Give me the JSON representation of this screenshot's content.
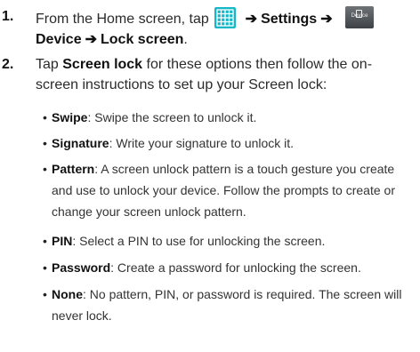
{
  "steps": [
    {
      "number": "1.",
      "prefix": "From the Home screen, tap",
      "arrow": "➔",
      "settings": "Settings",
      "device_icon_caption": "Device",
      "device": "Device",
      "lock_screen": "Lock screen",
      "period": "."
    },
    {
      "number": "2.",
      "tap": "Tap",
      "screen_lock": "Screen lock",
      "rest": "for these options then follow the on-screen instructions to set up your Screen lock:"
    }
  ],
  "options": [
    {
      "term": "Swipe",
      "desc": ": Swipe the screen to unlock it."
    },
    {
      "term": "Signature",
      "desc": ": Write your signature to unlock it."
    },
    {
      "term": "Pattern",
      "desc": ": A screen unlock pattern is a touch gesture you create and use to unlock your device. Follow the prompts to create or change your screen unlock pattern."
    },
    {
      "term": "PIN",
      "desc": ": Select a PIN to use for unlocking the screen."
    },
    {
      "term": "Password",
      "desc": ": Create a password for unlocking the screen."
    },
    {
      "term": "None",
      "desc": ": No pattern, PIN, or password is required. The screen will never lock."
    }
  ],
  "icons": {
    "apps": "apps-grid-icon",
    "device": "device-settings-icon",
    "apps_color": "#16b8c8"
  }
}
